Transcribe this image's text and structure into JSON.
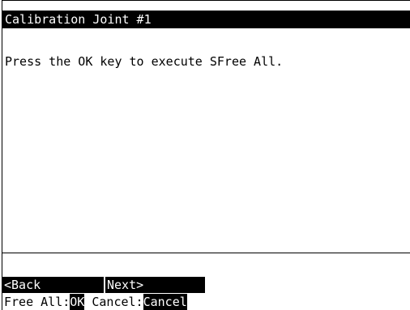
{
  "header": {
    "title": "Calibration Joint #1"
  },
  "main": {
    "message": "Press the OK key to execute SFree All."
  },
  "softkeys": {
    "back_label": "<Back",
    "next_label": "Next>"
  },
  "keys": {
    "free_all_label": "Free All:",
    "ok_label": "OK",
    "cancel_label": " Cancel:",
    "cancel_key_label": "Cancel"
  },
  "colors": {
    "background": "#ffffff",
    "foreground": "#000000",
    "inverse_text": "#ffffff"
  }
}
